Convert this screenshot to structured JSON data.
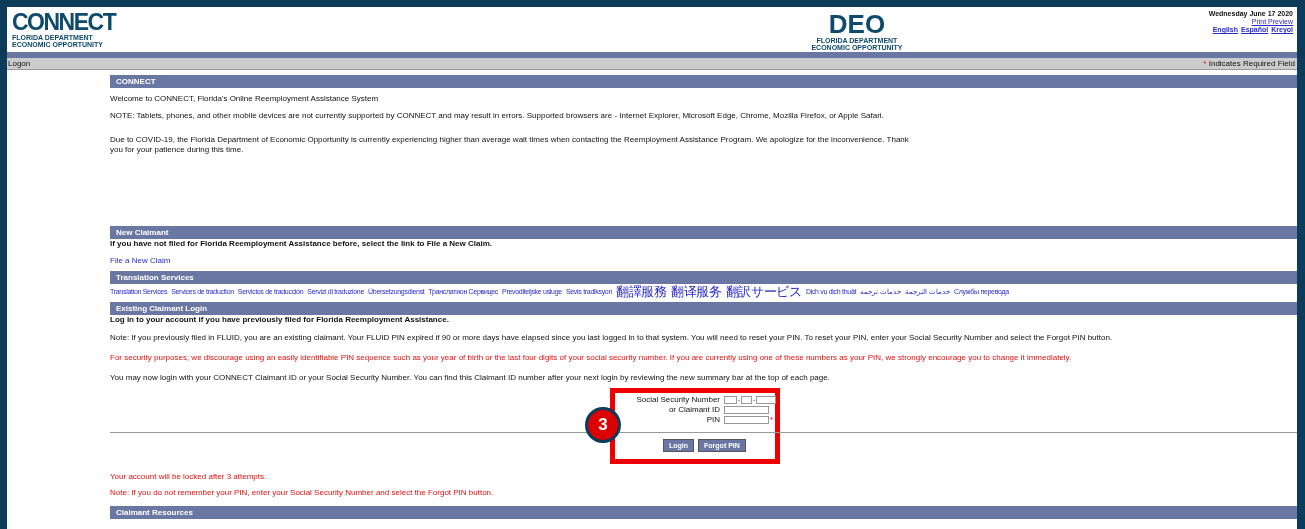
{
  "header": {
    "left_logo": {
      "word": "CONNECT",
      "line1": "FLORIDA DEPARTMENT",
      "line2": "ECONOMIC OPPORTUNITY"
    },
    "center_logo": {
      "word": "DEO",
      "line1": "FLORIDA DEPARTMENT",
      "line2": "ECONOMIC OPPORTUNITY"
    },
    "date": "Wednesday June 17 2020",
    "print_preview": "Print Preview",
    "languages": [
      "English",
      "Español",
      "Kreyol"
    ]
  },
  "nav_bar": {
    "page": "Logon",
    "required_mark": "*",
    "required_note": "Indicates Required Field"
  },
  "connect": {
    "title": "CONNECT",
    "welcome": "Welcome to CONNECT, Florida's Online Reemployment Assistance System",
    "note": "NOTE: Tablets, phones, and other mobile devices are not currently supported by CONNECT and may result in errors. Supported browsers are - Internet Explorer, Microsoft Edge, Chrome, Mozilla Firefox, or Apple Safari.",
    "covid": "Due to COVID-19, the Florida Department of Economic Opportunity is currently experiencing higher than average wait times when contacting the Reemployment Assistance Program. We apologize for the inconvenience. Thank you for your patience during this time."
  },
  "new_claimant": {
    "title": "New Claimant",
    "intro": "If you have not filed for Florida Reemployment Assistance before, select the link to File a New Claim.",
    "link": "File a New Claim"
  },
  "translation": {
    "title": "Translation Services",
    "links": [
      "Translation Services",
      "Services de traduction",
      "Servicios de traducción",
      "Servizi di traduzione",
      "Übersetzungsdienst",
      "Транслатион Сервицес",
      "Prevoditeljske usluge",
      "Sèvis tradiksyon",
      "翻譯服務",
      "翻译服务",
      "翻訳サービス",
      "Dịch vụ dịch thuật",
      "خدمات ترجمه",
      "خدمات الترجمة",
      "Службы перевода"
    ]
  },
  "login": {
    "title": "Existing Claimant Login",
    "intro": "Log in to your account if you have previously filed for Florida Reemployment Assistance.",
    "fluid_note": "Note: If you previously filed in FLUID, you are an existing claimant. Your FLUID PIN expired if 90 or more days have elapsed since you last logged in to that system. You will need to reset your PIN. To reset your PIN, enter your Social Security Number and select the Forgot PIN button.",
    "security_note": "For security purposes, we discourage using an easily identifiable PIN sequence such as your year of birth or the last four digits of your social security number. If you are currently using one of these numbers as your PIN, we strongly encourage you to change it immediately.",
    "id_note": "You may now login with your CONNECT Claimant ID or your Social Security Number. You can find this Claimant ID number after your next login by reviewing the new summary bar at the top of each page.",
    "ssn_label": "Social Security Number",
    "ssn_sep": [
      "-",
      "-"
    ],
    "claimant_label": "or Claimant ID",
    "pin_label": "PIN",
    "pin_required": "*",
    "buttons": [
      "Login",
      "Forgot PIN"
    ],
    "annotation": "3",
    "lock_note": "Your account will be locked after 3 attempts.",
    "forgot_note": "Note: If you do not remember your PIN, enter your Social Security Number and select the Forgot PIN button."
  },
  "resources": {
    "title": "Claimant Resources"
  }
}
